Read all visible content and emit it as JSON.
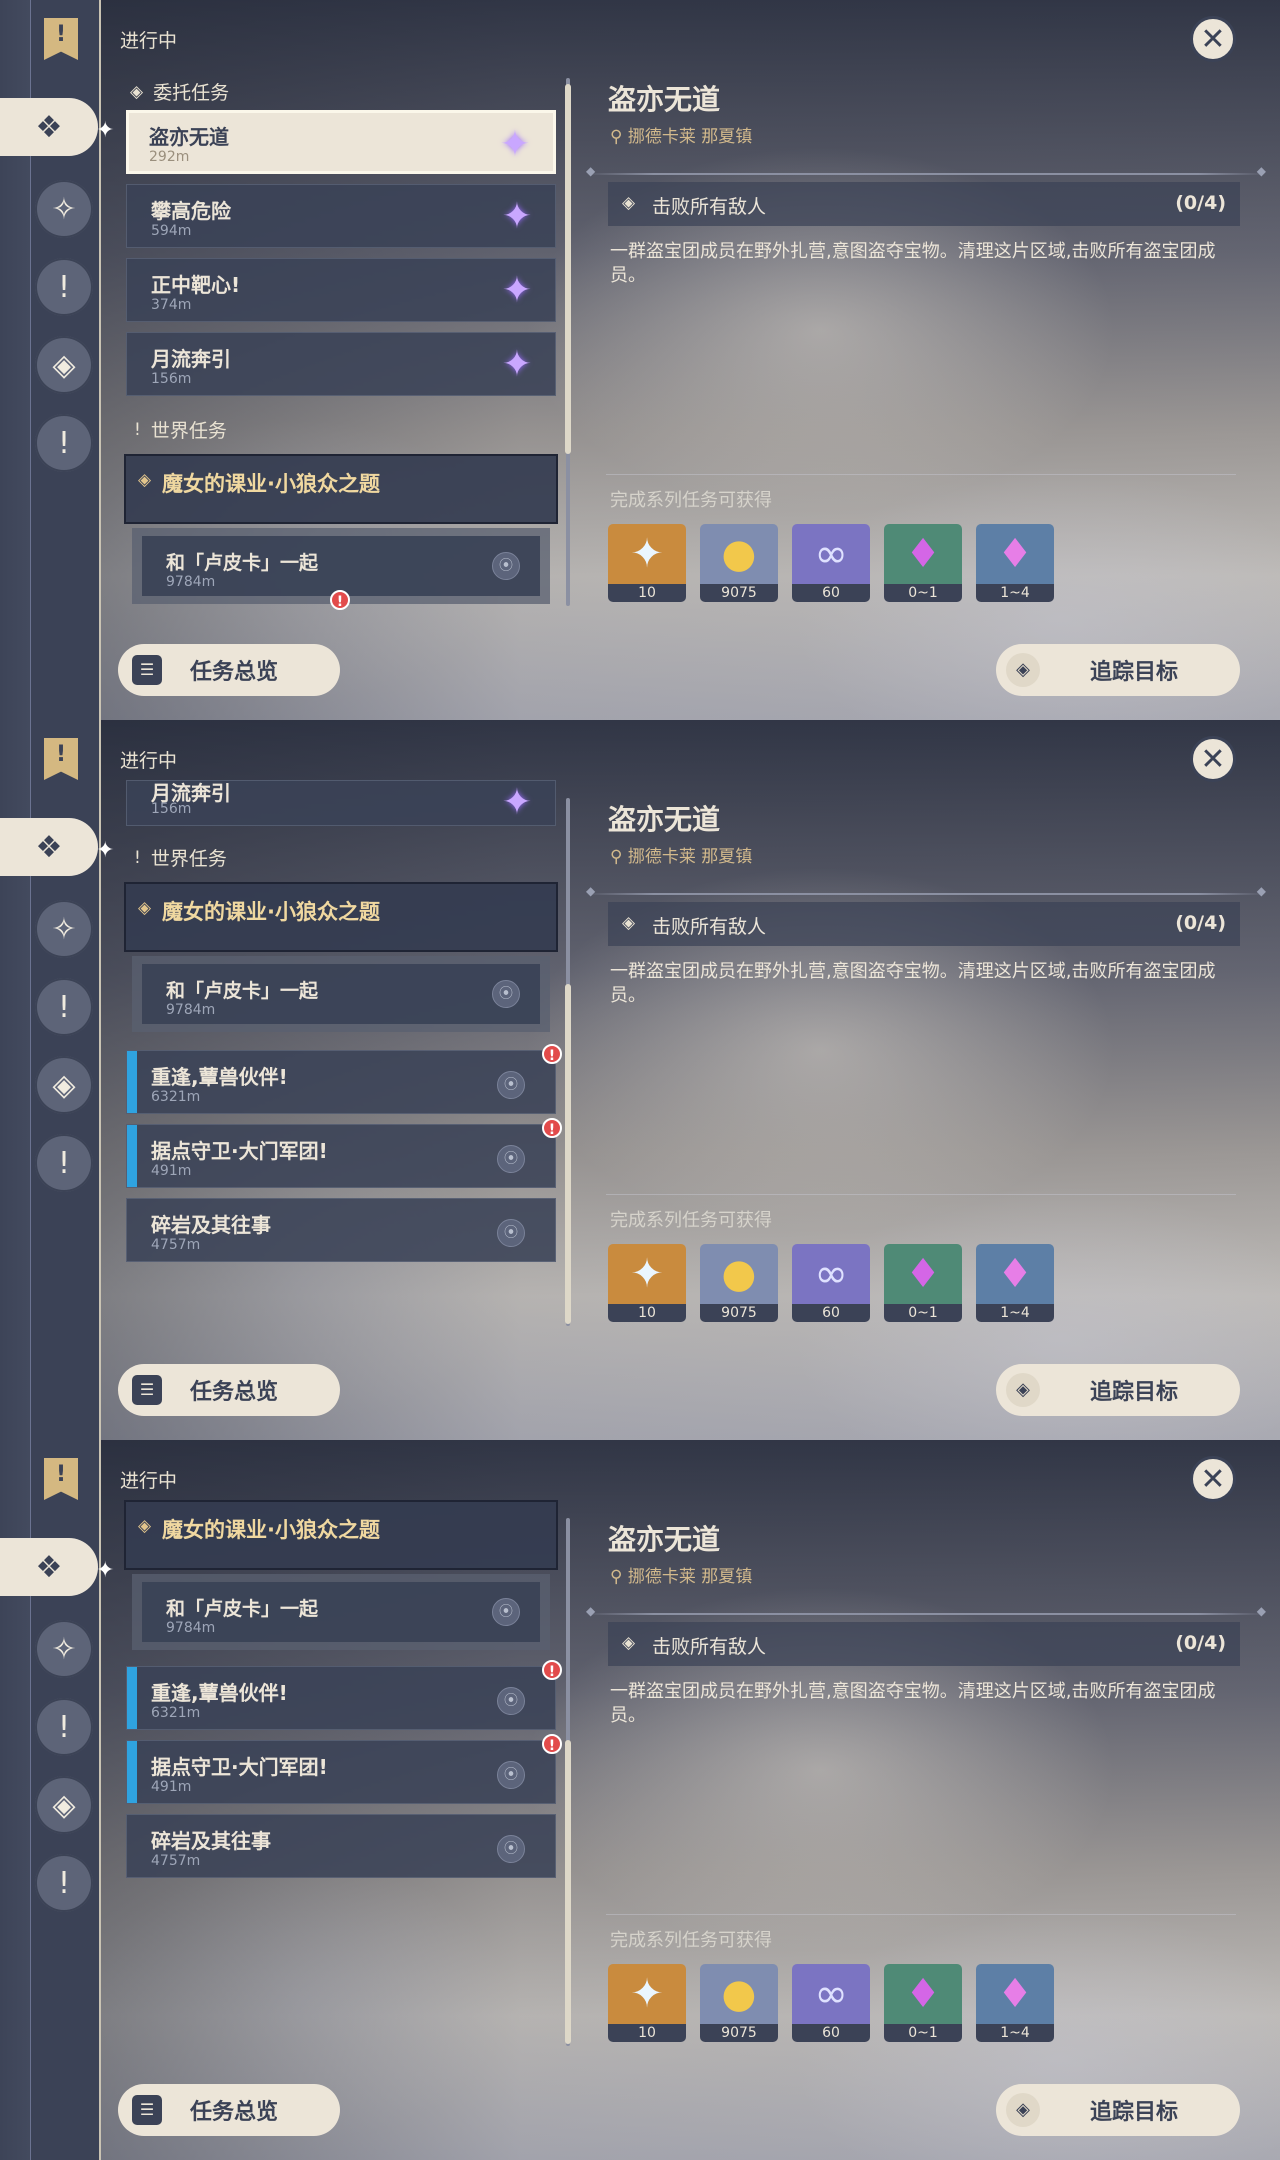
{
  "status_label": "进行中",
  "categories": {
    "commission": "委托任务",
    "world": "世界任务"
  },
  "commissions": [
    {
      "name": "盗亦无道",
      "distance": "292m"
    },
    {
      "name": "攀高危险",
      "distance": "594m"
    },
    {
      "name": "正中靶心!",
      "distance": "374m"
    },
    {
      "name": "月流奔引",
      "distance": "156m"
    }
  ],
  "world_quest_group": {
    "title": "魔女的课业·小狼众之题",
    "sub_quest": {
      "name": "和「卢皮卡」一起",
      "distance": "9784m"
    }
  },
  "world_quests": [
    {
      "name": "重逢,蕈兽伙伴!",
      "distance": "6321m"
    },
    {
      "name": "据点守卫·大门军团!",
      "distance": "491m"
    },
    {
      "name": "碎岩及其往事",
      "distance": "4757m"
    }
  ],
  "detail": {
    "title": "盗亦无道",
    "location": "挪德卡莱 那夏镇",
    "objective": "击败所有敌人",
    "progress": "(0/4)",
    "description": "一群盗宝团成员在野外扎营,意图盗夺宝物。清理这片区域,击败所有盗宝团成员。",
    "rewards_label": "完成系列任务可获得",
    "rewards": [
      {
        "icon": "primogem-icon",
        "qty": "10",
        "bg": "#c98b3e",
        "color": "#eaf6ff"
      },
      {
        "icon": "mora-icon",
        "qty": "9075",
        "bg": "#7f8db0",
        "color": "#f2c84b"
      },
      {
        "icon": "companionship-exp-icon",
        "qty": "60",
        "bg": "#7b74c2",
        "color": "#dfe1ff"
      },
      {
        "icon": "crystal-chunk-icon",
        "qty": "0~1",
        "bg": "#4f8a76",
        "color": "#d466e6"
      },
      {
        "icon": "crystal-cluster-icon",
        "qty": "1~4",
        "bg": "#5d7fa6",
        "color": "#e77ee7"
      }
    ]
  },
  "buttons": {
    "overview": "任务总览",
    "track": "追踪目标"
  },
  "icons": {
    "star": "✦",
    "alert": "!",
    "close": "✕",
    "pin": "⦿"
  }
}
